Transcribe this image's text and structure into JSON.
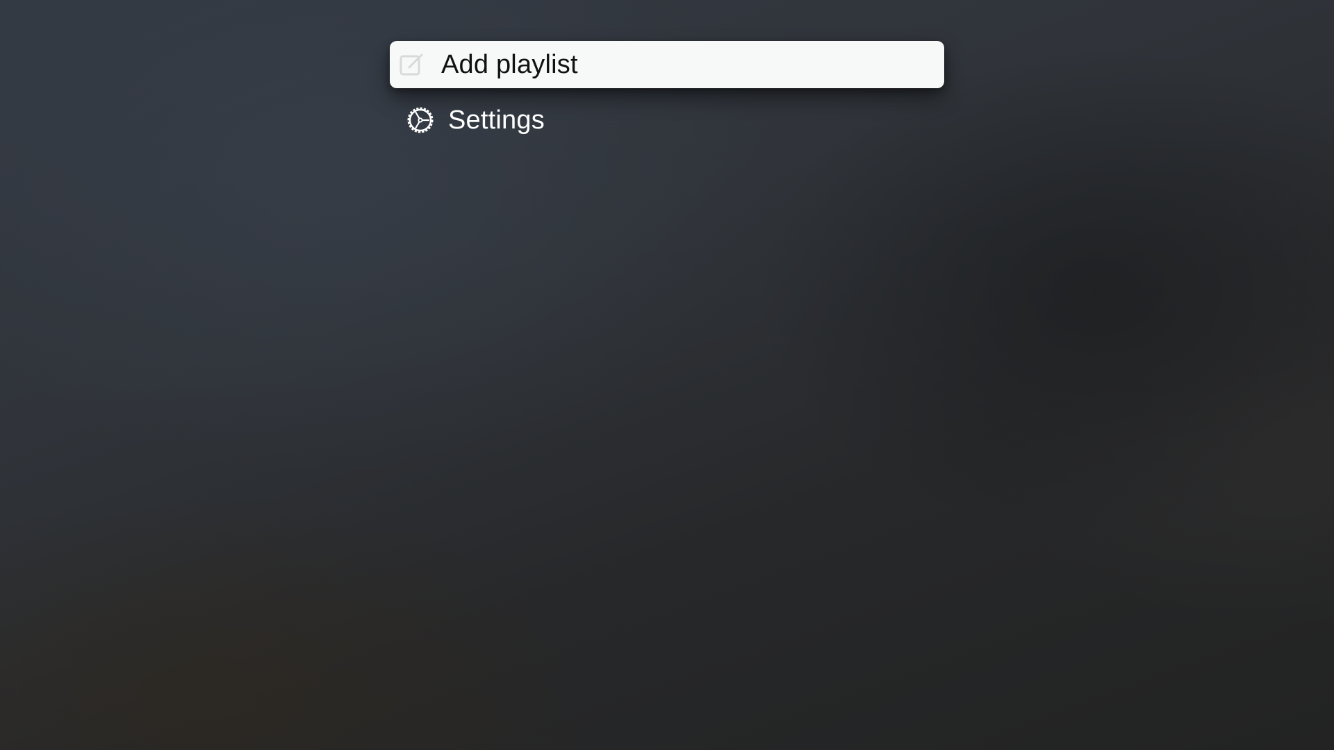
{
  "menu": {
    "items": [
      {
        "label": "Add playlist",
        "icon": "compose-icon",
        "focused": true
      },
      {
        "label": "Settings",
        "icon": "gear-icon",
        "focused": false
      }
    ]
  },
  "colors": {
    "focused_background": "#f7f8f8",
    "focused_text": "#111111",
    "text": "#ffffff"
  }
}
